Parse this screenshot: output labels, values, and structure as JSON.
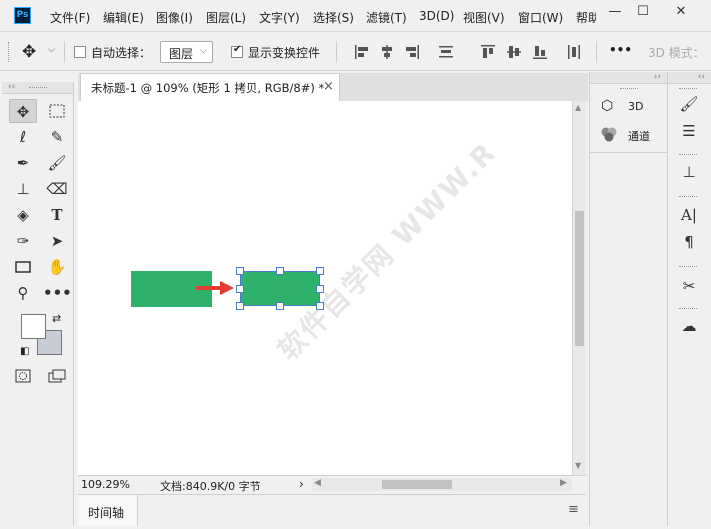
{
  "menubar": {
    "app_icon": "Ps",
    "items": [
      "文件(F)",
      "编辑(E)",
      "图像(I)",
      "图层(L)",
      "文字(Y)",
      "选择(S)",
      "滤镜(T)",
      "3D(D)",
      "视图(V)",
      "窗口(W)",
      "帮助"
    ],
    "window_controls": [
      "—",
      "☐",
      "✕"
    ]
  },
  "options": {
    "auto_select_label": "自动选择：",
    "auto_select_value": "图层",
    "show_transform_label": "显示变换控件",
    "more_label": "•••",
    "mode_3d_label": "3D 模式："
  },
  "document": {
    "tab_title": "未标题-1 @ 109% (矩形 1 拷贝, RGB/8#) *",
    "tab_close": "×",
    "watermark": "软件自学网 WWW.RJZXW.COM"
  },
  "status": {
    "zoom": "109.29%",
    "doc_info": "文档:840.9K/0 字节",
    "arrow": "›"
  },
  "timeline": {
    "label": "时间轴"
  },
  "right_panel": {
    "items": [
      {
        "label": "3D",
        "icon": "cube-icon"
      },
      {
        "label": "通道",
        "icon": "channels-icon"
      }
    ]
  },
  "colors": {
    "shape_fill": "#2eb16b",
    "arrow": "#e53935",
    "accent": "#4a7ad1"
  }
}
